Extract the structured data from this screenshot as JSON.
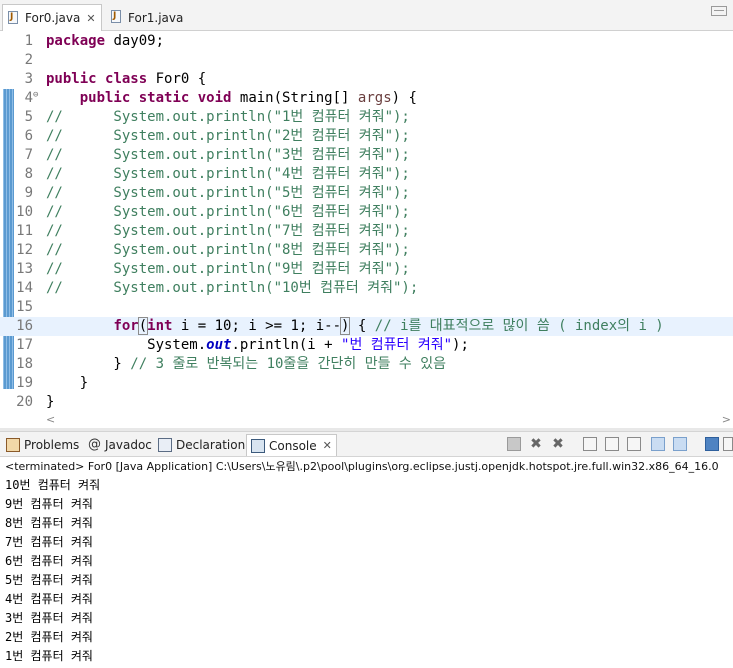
{
  "editor_tabs": [
    {
      "label": "For0.java",
      "close": "✕",
      "active": true
    },
    {
      "label": "For1.java",
      "active": false
    }
  ],
  "code_lines": [
    {
      "num": "1",
      "tokens": [
        {
          "t": "kw",
          "v": "package"
        },
        {
          "t": "",
          "v": " day09;"
        }
      ]
    },
    {
      "num": "2",
      "tokens": []
    },
    {
      "num": "3",
      "tokens": [
        {
          "t": "kw",
          "v": "public"
        },
        {
          "t": "",
          "v": " "
        },
        {
          "t": "kw",
          "v": "class"
        },
        {
          "t": "",
          "v": " For0 {"
        }
      ]
    },
    {
      "num": "4",
      "fold": "⊖",
      "tokens": [
        {
          "t": "",
          "v": "    "
        },
        {
          "t": "kw",
          "v": "public"
        },
        {
          "t": "",
          "v": " "
        },
        {
          "t": "kw",
          "v": "static"
        },
        {
          "t": "",
          "v": " "
        },
        {
          "t": "kw",
          "v": "void"
        },
        {
          "t": "",
          "v": " main(String[] "
        },
        {
          "t": "prm",
          "v": "args"
        },
        {
          "t": "",
          "v": ") {"
        }
      ]
    },
    {
      "num": "5",
      "tokens": [
        {
          "t": "cm",
          "v": "//      System.out.println(\"1번 컴퓨터 켜줘\");"
        }
      ]
    },
    {
      "num": "6",
      "tokens": [
        {
          "t": "cm",
          "v": "//      System.out.println(\"2번 컴퓨터 켜줘\");"
        }
      ]
    },
    {
      "num": "7",
      "tokens": [
        {
          "t": "cm",
          "v": "//      System.out.println(\"3번 컴퓨터 켜줘\");"
        }
      ]
    },
    {
      "num": "8",
      "tokens": [
        {
          "t": "cm",
          "v": "//      System.out.println(\"4번 컴퓨터 켜줘\");"
        }
      ]
    },
    {
      "num": "9",
      "tokens": [
        {
          "t": "cm",
          "v": "//      System.out.println(\"5번 컴퓨터 켜줘\");"
        }
      ]
    },
    {
      "num": "10",
      "tokens": [
        {
          "t": "cm",
          "v": "//      System.out.println(\"6번 컴퓨터 켜줘\");"
        }
      ]
    },
    {
      "num": "11",
      "tokens": [
        {
          "t": "cm",
          "v": "//      System.out.println(\"7번 컴퓨터 켜줘\");"
        }
      ]
    },
    {
      "num": "12",
      "tokens": [
        {
          "t": "cm",
          "v": "//      System.out.println(\"8번 컴퓨터 켜줘\");"
        }
      ]
    },
    {
      "num": "13",
      "tokens": [
        {
          "t": "cm",
          "v": "//      System.out.println(\"9번 컴퓨터 켜줘\");"
        }
      ]
    },
    {
      "num": "14",
      "tokens": [
        {
          "t": "cm",
          "v": "//      System.out.println(\"10번 컴퓨터 켜줘\");"
        }
      ]
    },
    {
      "num": "15",
      "tokens": []
    },
    {
      "num": "16",
      "current": true,
      "tokens": [
        {
          "t": "",
          "v": "        "
        },
        {
          "t": "kw",
          "v": "for"
        },
        {
          "t": "bracket",
          "v": "("
        },
        {
          "t": "kw",
          "v": "int"
        },
        {
          "t": "",
          "v": " i = 10; i >= 1; i--"
        },
        {
          "t": "bracket",
          "v": ")"
        },
        {
          "t": "",
          "v": " { "
        },
        {
          "t": "cm",
          "v": "// i를 대표적으로 많이 씀 ( index의 i )"
        }
      ]
    },
    {
      "num": "17",
      "tokens": [
        {
          "t": "",
          "v": "            System."
        },
        {
          "t": "fld",
          "v": "out"
        },
        {
          "t": "",
          "v": ".println(i + "
        },
        {
          "t": "str",
          "v": "\"번 컴퓨터 켜줘\""
        },
        {
          "t": "",
          "v": ");"
        }
      ]
    },
    {
      "num": "18",
      "tokens": [
        {
          "t": "",
          "v": "        } "
        },
        {
          "t": "cm",
          "v": "// 3 줄로 반복되는 10줄을 간단히 만들 수 있음"
        }
      ]
    },
    {
      "num": "19",
      "tokens": [
        {
          "t": "",
          "v": "    }"
        }
      ]
    },
    {
      "num": "20",
      "tokens": [
        {
          "t": "",
          "v": "}"
        }
      ]
    }
  ],
  "scroll_left": "<",
  "scroll_right": ">",
  "view_tabs": [
    {
      "label": "Problems",
      "icon": "problems-icon"
    },
    {
      "label": "Javadoc",
      "icon": "javadoc-icon",
      "glyph": "@"
    },
    {
      "label": "Declaration",
      "icon": "declaration-icon"
    },
    {
      "label": "Console",
      "icon": "console-icon",
      "active": true,
      "close": "✕"
    }
  ],
  "console": {
    "status": "<terminated> For0 [Java Application] C:\\Users\\노유림\\.p2\\pool\\plugins\\org.eclipse.justj.openjdk.hotspot.jre.full.win32.x86_64_16.0",
    "output": [
      "10번 컴퓨터 켜줘",
      "9번 컴퓨터 켜줘",
      "8번 컴퓨터 켜줘",
      "7번 컴퓨터 켜줘",
      "6번 컴퓨터 켜줘",
      "5번 컴퓨터 켜줘",
      "4번 컴퓨터 켜줘",
      "3번 컴퓨터 켜줘",
      "2번 컴퓨터 켜줘",
      "1번 컴퓨터 켜줘"
    ]
  },
  "toolbar_icons": [
    "stop-icon",
    "remove-launch-icon",
    "remove-all-icon",
    "clear-console-icon",
    "scroll-lock-icon",
    "word-wrap-icon",
    "show-on-output-icon",
    "show-on-error-icon",
    "pin-console-icon",
    "open-console-icon"
  ],
  "colors": {
    "keyword": "#7f0055",
    "string": "#2a00ff",
    "comment": "#3f7f5f",
    "field": "#0000c0",
    "current_line": "#e8f2fe"
  }
}
